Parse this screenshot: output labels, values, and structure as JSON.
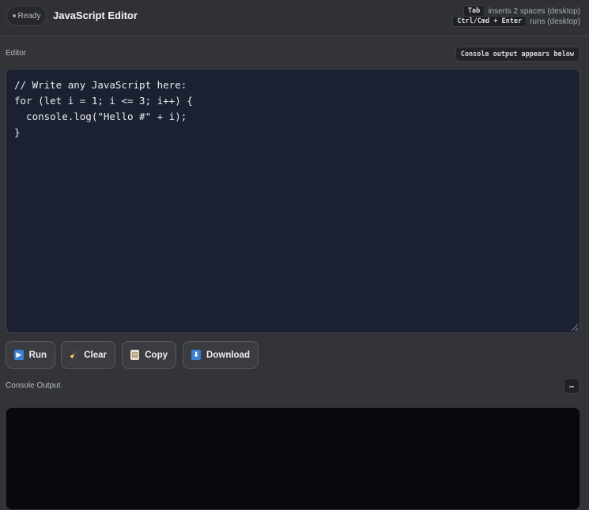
{
  "header": {
    "status": "Ready",
    "title": "JavaScript Editor",
    "hints": [
      {
        "key": "Tab",
        "text": "inserts 2 spaces (desktop)"
      },
      {
        "key": "Ctrl/Cmd + Enter",
        "text": "runs (desktop)"
      }
    ]
  },
  "editor": {
    "label": "Editor",
    "tag": "Console output appears below",
    "code_lines": [
      "// Write any JavaScript here:",
      "for (let i = 1; i <= 3; i++) {",
      "  console.log(\"Hello #\" + i);",
      "}"
    ]
  },
  "toolbar": {
    "run_label": "Run",
    "clear_label": "Clear",
    "copy_label": "Copy",
    "download_label": "Download"
  },
  "console": {
    "label": "Console Output",
    "collapse_symbol": "–"
  }
}
